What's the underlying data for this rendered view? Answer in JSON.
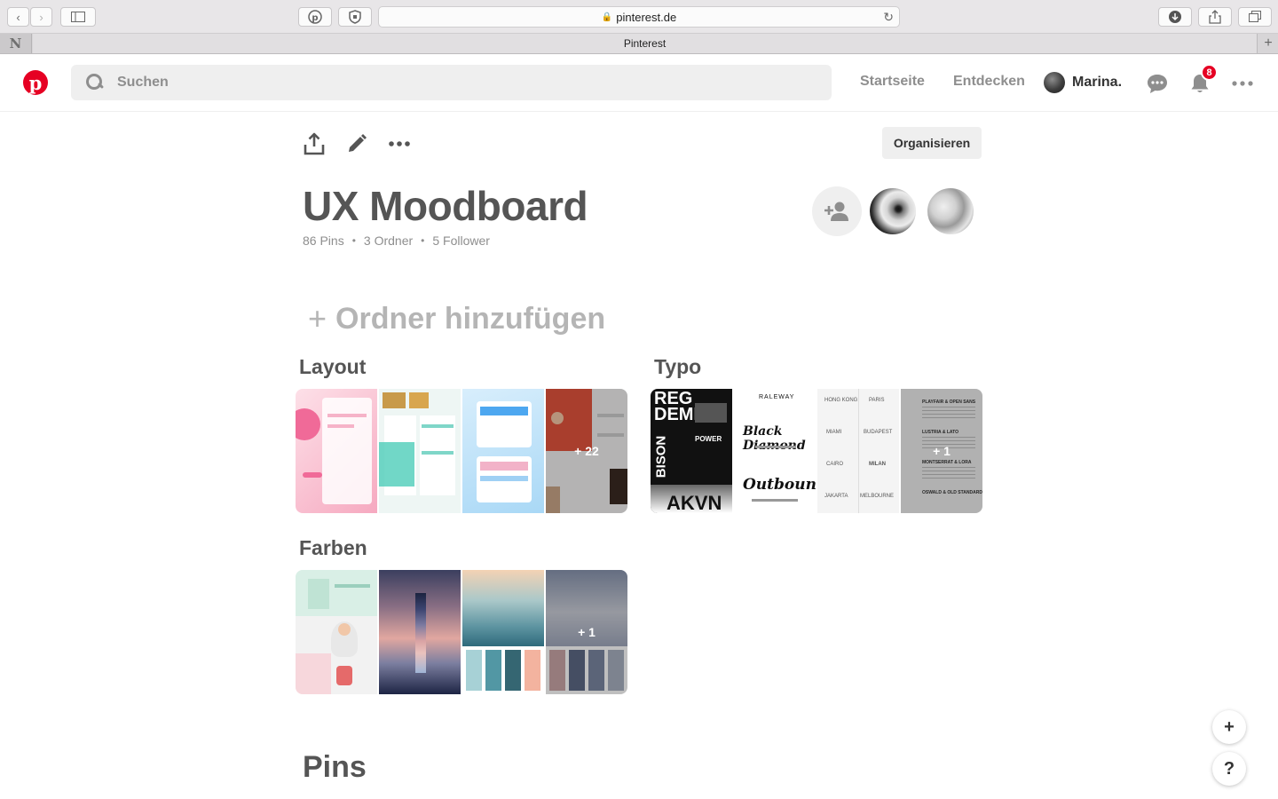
{
  "browser": {
    "url": "pinterest.de",
    "tab_title": "Pinterest",
    "pinned_tab": "N"
  },
  "header": {
    "search_placeholder": "Suchen",
    "nav": [
      "Startseite",
      "Entdecken"
    ],
    "user_name": "Marina.",
    "notification_count": "8"
  },
  "board": {
    "organize_label": "Organisieren",
    "title": "UX Moodboard",
    "pins_count": "86 Pins",
    "folders_count": "3 Ordner",
    "followers_count": "5 Follower",
    "add_section_label": "Ordner hinzufügen",
    "sections": [
      {
        "name": "Layout",
        "more": "+ 22"
      },
      {
        "name": "Typo",
        "more": "+ 1"
      },
      {
        "name": "Farben",
        "more": "+ 1"
      }
    ],
    "pins_heading": "Pins"
  },
  "typo_tiles": {
    "t1": [
      "REG",
      "DEMI",
      "BISON",
      "POWER",
      "AKVN"
    ],
    "t2": [
      "RALEWAY",
      "Black Diamond",
      "Outbound"
    ],
    "t3": [
      "HONG KONG",
      "PARIS",
      "MIAMI",
      "BUDAPEST",
      "CAIRO",
      "MILAN",
      "JAKARTA",
      "MELBOURNE"
    ],
    "t4": [
      "PLAYFAIR & OPEN SANS",
      "LUSTRIA & LATO",
      "MONTSERRAT & LORA",
      "OSWALD & OLD STANDARD"
    ]
  },
  "floating": {
    "add": "+",
    "help": "?"
  },
  "colors": {
    "brand": "#e60023",
    "text_dark": "#555555",
    "text_muted": "#8e8e8e"
  }
}
